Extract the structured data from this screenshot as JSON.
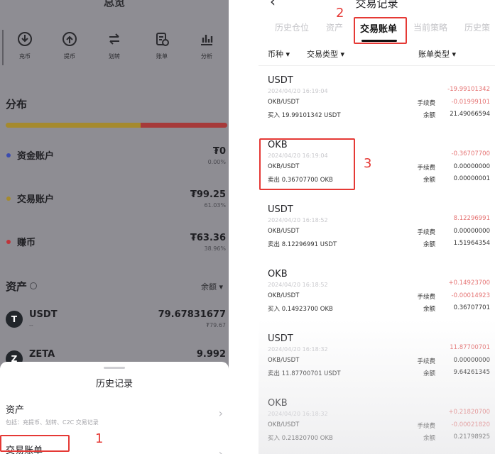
{
  "left": {
    "top_title": "总览",
    "actions": [
      {
        "label": "充币",
        "icon": "deposit-icon"
      },
      {
        "label": "提币",
        "icon": "withdraw-icon"
      },
      {
        "label": "划转",
        "icon": "transfer-icon"
      },
      {
        "label": "账单",
        "icon": "bill-icon"
      },
      {
        "label": "分析",
        "icon": "analysis-icon"
      }
    ],
    "distribution_title": "分布",
    "distribution_bar": [
      {
        "color": "#a58a2e",
        "fraction": 0.61
      },
      {
        "color": "#a63a3a",
        "fraction": 0.39
      }
    ],
    "accounts": [
      {
        "name": "资金账户",
        "amount": "₮0",
        "percent": "0.00%",
        "color": "#3b4cb0"
      },
      {
        "name": "交易账户",
        "amount": "₮99.25",
        "percent": "61.03%",
        "color": "#a58a2e"
      },
      {
        "name": "赚币",
        "amount": "₮63.36",
        "percent": "38.96%",
        "color": "#c0343a"
      }
    ],
    "assets_title": "资产",
    "sort_label": "余额 ▾",
    "coins": [
      {
        "symbol": "USDT",
        "logo": "T",
        "sub": "--",
        "amount": "79.67831677",
        "fiat": "₮79.67"
      },
      {
        "symbol": "ZETA",
        "logo": "Z",
        "sub": "",
        "amount": "9.992",
        "fiat": ""
      }
    ],
    "sheet": {
      "title": "历史记录",
      "rows": [
        {
          "label": "资产",
          "desc": "包括：充提币、划转、C2C 交易记录"
        },
        {
          "label": "交易账单",
          "desc": ""
        }
      ]
    }
  },
  "annotations": {
    "step1": "1",
    "step2": "2",
    "step3": "3"
  },
  "right": {
    "title": "交易记录",
    "back": "‹",
    "tabs": [
      "历史仓位",
      "资产",
      "交易账单",
      "当前策略",
      "历史策"
    ],
    "active_tab": 2,
    "filters": [
      "币种 ▾",
      "交易类型 ▾",
      "账单类型 ▾"
    ],
    "fee_label": "手续费",
    "balance_label": "余额",
    "transactions": [
      {
        "currency": "USDT",
        "time": "2024/04/20 16:19:04",
        "pair": "OKB/USDT",
        "action": "买入 19.99101342 USDT",
        "change": "-19.99101342",
        "fee": "-0.01999101",
        "fee_negative": true,
        "balance": "21.49066594"
      },
      {
        "currency": "OKB",
        "time": "2024/04/20 16:19:04",
        "pair": "OKB/USDT",
        "action": "卖出 0.36707700 OKB",
        "change": "-0.36707700",
        "fee": "0.00000000",
        "fee_negative": false,
        "balance": "0.00000001"
      },
      {
        "currency": "USDT",
        "time": "2024/04/20 16:18:52",
        "pair": "OKB/USDT",
        "action": "卖出 8.12296991 USDT",
        "change": "8.12296991",
        "fee": "0.00000000",
        "fee_negative": false,
        "balance": "1.51964354"
      },
      {
        "currency": "OKB",
        "time": "2024/04/20 16:18:52",
        "pair": "OKB/USDT",
        "action": "买入 0.14923700 OKB",
        "change": "+0.14923700",
        "fee": "-0.00014923",
        "fee_negative": true,
        "balance": "0.36707701"
      },
      {
        "currency": "USDT",
        "time": "2024/04/20 16:18:32",
        "pair": "OKB/USDT",
        "action": "卖出 11.87700701 USDT",
        "change": "11.87700701",
        "fee": "0.00000000",
        "fee_negative": false,
        "balance": "9.64261345"
      },
      {
        "currency": "OKB",
        "time": "2024/04/20 16:18:32",
        "pair": "OKB/USDT",
        "action": "买入 0.21820700 OKB",
        "change": "+0.21820700",
        "fee": "-0.00021820",
        "fee_negative": true,
        "balance": "0.21798925"
      }
    ]
  }
}
